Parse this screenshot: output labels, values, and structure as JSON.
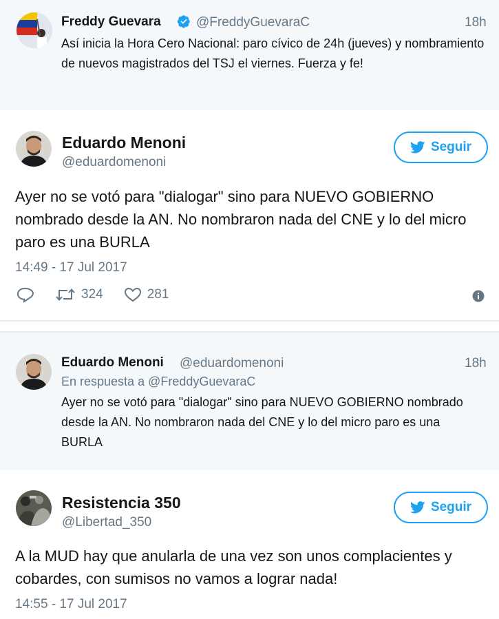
{
  "colors": {
    "accent": "#1da1f2",
    "muted": "#657786",
    "text": "#14171a",
    "tweet_bg": "#f5f8fa"
  },
  "tweet1": {
    "name": "Freddy Guevara",
    "verified_icon": "verified-badge-icon",
    "handle": "@FreddyGuevaraC",
    "time": "18h",
    "text": "Así inicia la Hora Cero Nacional: paro cívico de 24h (jueves) y nombramiento de nuevos magistrados del TSJ el viernes. Fuerza y fe!"
  },
  "tweet2": {
    "name": "Eduardo Menoni",
    "handle": "@eduardomenoni",
    "follow_label": "Seguir",
    "text": "Ayer no se votó para \"dialogar\" sino para NUEVO GOBIERNO nombrado desde la AN. No nombraron nada del CNE y lo del micro paro es una BURLA",
    "timestamp": "14:49 - 17 Jul 2017",
    "retweets": "324",
    "likes": "281",
    "icons": [
      "reply-icon",
      "retweet-icon",
      "like-icon",
      "info-icon"
    ]
  },
  "tweet3": {
    "name": "Eduardo Menoni",
    "handle": "@eduardomenoni",
    "time": "18h",
    "reply_prefix": "En respuesta a",
    "reply_handle": "@FreddyGuevaraC",
    "text": "Ayer no se votó para \"dialogar\" sino para NUEVO GOBIERNO nombrado desde la AN. No nombraron nada del CNE y lo del micro paro es una BURLA"
  },
  "tweet4": {
    "name": "Resistencia 350",
    "handle": "@Libertad_350",
    "follow_label": "Seguir",
    "text": "A la MUD hay que anularla de una vez son unos complacientes y cobardes, con sumisos no vamos a lograr nada!",
    "timestamp": "14:55 - 17 Jul 2017"
  }
}
